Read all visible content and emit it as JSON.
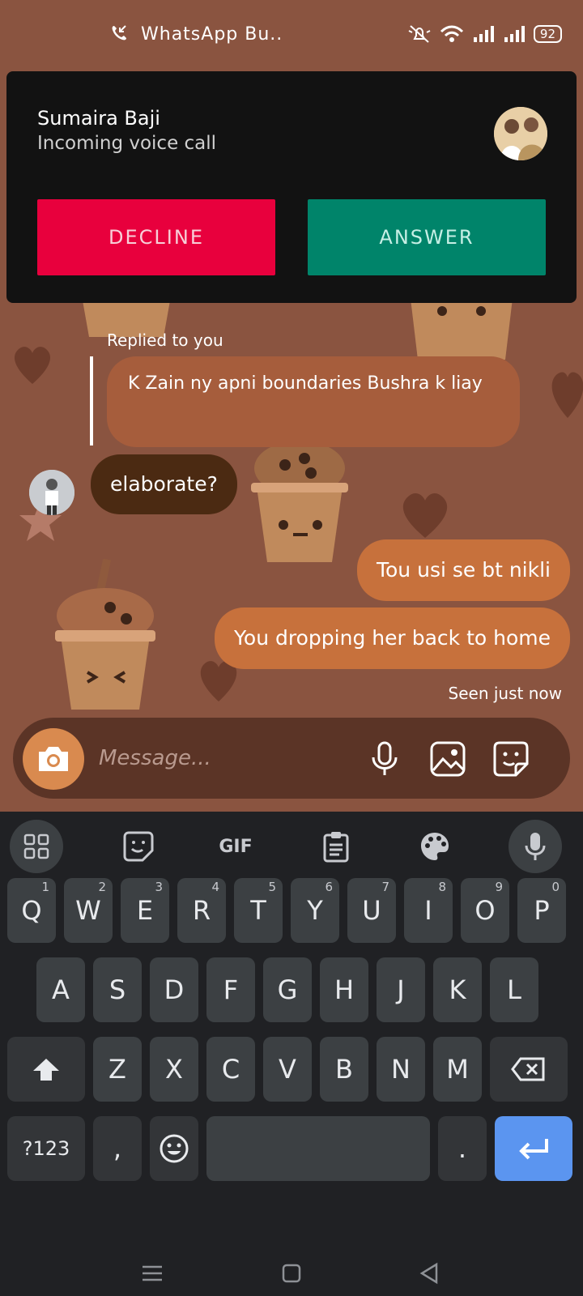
{
  "status_bar": {
    "app_title": "WhatsApp Bu..",
    "battery": "92"
  },
  "call": {
    "caller_name": "Sumaira Baji",
    "subtitle": "Incoming voice call",
    "decline_label": "DECLINE",
    "answer_label": "ANSWER"
  },
  "messages": {
    "replied_label": "Replied to you",
    "reply_quote": "K Zain ny apni boundaries Bushra k liay",
    "incoming": "elaborate?",
    "outgoing_1": "Tou usi se bt nikli",
    "outgoing_2": "You dropping her back to home",
    "seen": "Seen just now"
  },
  "composer": {
    "placeholder": "Message..."
  },
  "keyboard": {
    "toolbar": {
      "gif_label": "GIF"
    },
    "row1": [
      "Q",
      "W",
      "E",
      "R",
      "T",
      "Y",
      "U",
      "I",
      "O",
      "P"
    ],
    "row1_hints": [
      "1",
      "2",
      "3",
      "4",
      "5",
      "6",
      "7",
      "8",
      "9",
      "0"
    ],
    "row2": [
      "A",
      "S",
      "D",
      "F",
      "G",
      "H",
      "J",
      "K",
      "L"
    ],
    "row3": [
      "Z",
      "X",
      "C",
      "V",
      "B",
      "N",
      "M"
    ],
    "symbols_label": "?123",
    "comma": ",",
    "period": "."
  },
  "colors": {
    "wallpaper": "#8a5440",
    "decline": "#e8003d",
    "answer": "#00846a",
    "outgoing_bubble": "#c7713c",
    "incoming_bubble": "#4b2a12",
    "enter_key": "#5b95f0"
  }
}
